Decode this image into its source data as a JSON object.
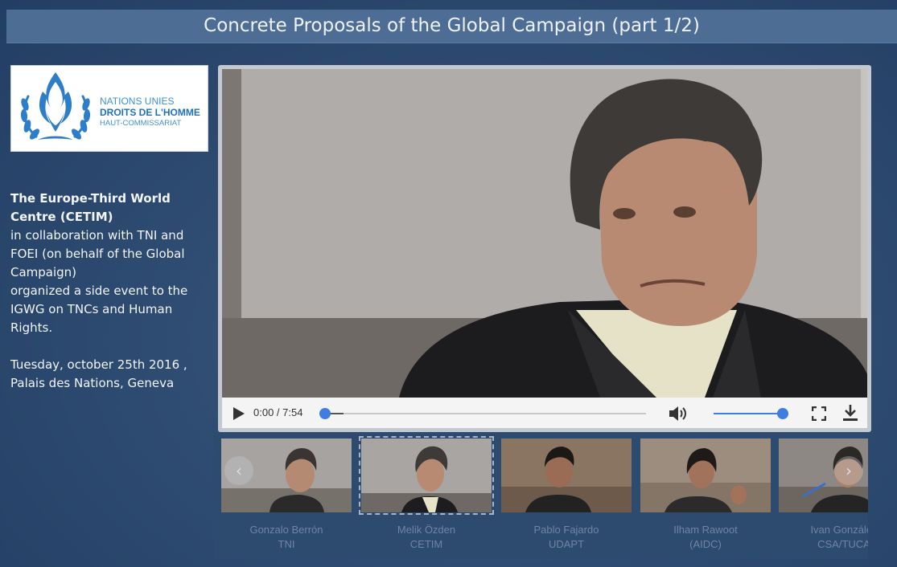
{
  "page": {
    "title": "Concrete Proposals of the Global Campaign (part 1/2)"
  },
  "logo": {
    "icon": "un-human-rights-emblem",
    "line1": "NATIONS UNIES",
    "line2": "DROITS DE L'HOMME",
    "line3": "HAUT-COMMISSARIAT"
  },
  "description": {
    "org": "The Europe-Third World Centre (CETIM)",
    "collab": "in collaboration with TNI and FOEI (on behalf of the Global Campaign)",
    "event": "organized a side event to the IGWG on TNCs and Human Rights.",
    "date": "Tuesday, october 25th 2016 ,",
    "place": "Palais des Nations, Geneva"
  },
  "player": {
    "time": "0:00 / 7:54",
    "progress": 0.0,
    "buffered": 0.06,
    "volume": 1.0,
    "icons": {
      "play": "play-icon",
      "volume": "volume-icon",
      "fullscreen": "fullscreen-icon",
      "download": "download-icon"
    }
  },
  "playlist": {
    "prev_glyph": "‹",
    "next_glyph": "›",
    "items": [
      {
        "name": "Gonzalo Berrón",
        "org": "TNI",
        "active": false
      },
      {
        "name": "Melik Özden",
        "org": "CETIM",
        "active": true
      },
      {
        "name": "Pablo Fajardo",
        "org": "UDAPT",
        "active": false
      },
      {
        "name": "Ilham Rawoot",
        "org": "(AIDC)",
        "active": false
      },
      {
        "name": "Ivan González",
        "org": "CSA/TUCA",
        "active": false
      }
    ]
  },
  "colors": {
    "background": "#2f4c72",
    "title_bar": "#4d6d94",
    "accent": "#3f7de0",
    "thumb_text": "#6f85a3"
  }
}
